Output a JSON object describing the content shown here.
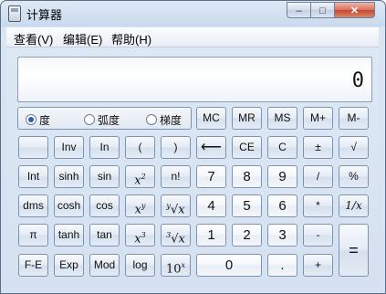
{
  "window": {
    "title": "计算器",
    "caption": {
      "minimize": "–",
      "maximize": "□",
      "close": "✕"
    }
  },
  "menu": [
    "查看(V)",
    "编辑(E)",
    "帮助(H)"
  ],
  "display": {
    "value": "0"
  },
  "angle_modes": [
    {
      "label": "度",
      "selected": true
    },
    {
      "label": "弧度",
      "selected": false
    },
    {
      "label": "梯度",
      "selected": false
    }
  ],
  "memory": [
    "MC",
    "MR",
    "MS",
    "M+",
    "M-"
  ],
  "keys": {
    "inv": "Inv",
    "ln": "In",
    "lparen": "(",
    "rparen": ")",
    "backspace": "⟵",
    "ce": "CE",
    "c": "C",
    "plusminus": "±",
    "sqrt": "√",
    "int": "Int",
    "sinh": "sinh",
    "sin": "sin",
    "x2": "x",
    "x2sup": "2",
    "fact": "n!",
    "n7": "7",
    "n8": "8",
    "n9": "9",
    "div": "/",
    "pct": "%",
    "dms": "dms",
    "cosh": "cosh",
    "cos": "cos",
    "xy": "x",
    "xysup": "y",
    "yroot": "√x",
    "yrootpre": "y",
    "n4": "4",
    "n5": "5",
    "n6": "6",
    "mul": "*",
    "recip": "1/x",
    "pi": "π",
    "tanh": "tanh",
    "tan": "tan",
    "x3": "x",
    "x3sup": "3",
    "cuberoot": "√x",
    "cuberootpre": "3",
    "n1": "1",
    "n2": "2",
    "n3": "3",
    "sub": "-",
    "eq": "=",
    "fe": "F-E",
    "exp": "Exp",
    "mod": "Mod",
    "log": "log",
    "tenx": "10",
    "tenxsup": "x",
    "n0": "0",
    "dot": ".",
    "add": "+"
  }
}
